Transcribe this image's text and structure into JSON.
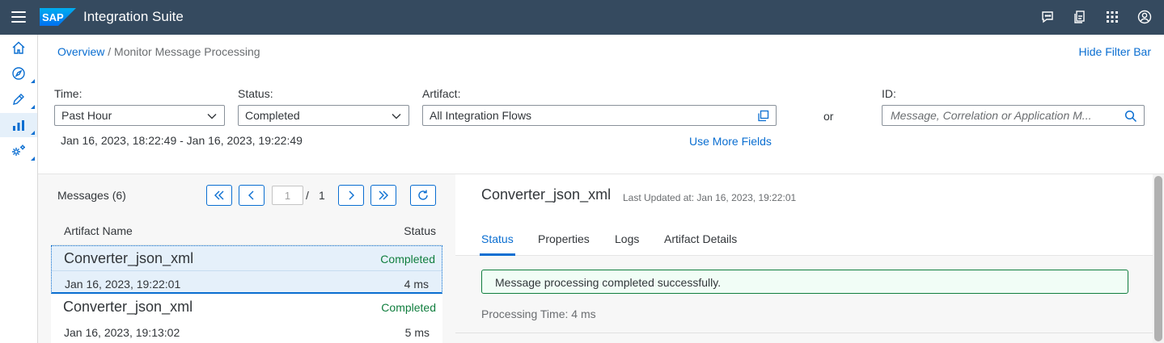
{
  "shell": {
    "logo_text": "SAP",
    "title": "Integration Suite",
    "icons": [
      "feedback-icon",
      "notifications-icon",
      "apps-grid-icon",
      "user-icon"
    ]
  },
  "sidenav": {
    "items": [
      "home-icon",
      "discover-icon",
      "design-icon",
      "monitor-icon",
      "settings-icon"
    ],
    "active": "monitor-icon"
  },
  "breadcrumb": {
    "link": "Overview",
    "separator": "/",
    "current": "Monitor Message Processing"
  },
  "filter": {
    "hide_label": "Hide Filter Bar",
    "time_label": "Time:",
    "time_value": "Past Hour",
    "status_label": "Status:",
    "status_value": "Completed",
    "artifact_label": "Artifact:",
    "artifact_value": "All Integration Flows",
    "id_label": "ID:",
    "id_placeholder": "Message, Correlation or Application M...",
    "or_text": "or",
    "range": "Jan 16, 2023, 18:22:49 - Jan 16, 2023, 19:22:49",
    "more_fields": "Use More Fields"
  },
  "messages": {
    "title": "Messages (6)",
    "page_current": "1",
    "page_sep": "/",
    "page_total": "1",
    "col_name": "Artifact Name",
    "col_status": "Status",
    "rows": [
      {
        "name": "Converter_json_xml",
        "status": "Completed",
        "date": "Jan 16, 2023, 19:22:01",
        "duration": "4 ms"
      },
      {
        "name": "Converter_json_xml",
        "status": "Completed",
        "date": "Jan 16, 2023, 19:13:02",
        "duration": "5 ms"
      }
    ]
  },
  "detail": {
    "title": "Converter_json_xml",
    "last_updated": "Last Updated at: Jan 16, 2023, 19:22:01",
    "tabs": [
      "Status",
      "Properties",
      "Logs",
      "Artifact Details"
    ],
    "active_tab": "Status",
    "status_message": "Message processing completed successfully.",
    "processing_time": "Processing Time: 4 ms"
  },
  "colors": {
    "shell_bg": "#354a5f",
    "accent": "#0a6ed1",
    "success": "#107e3e"
  }
}
